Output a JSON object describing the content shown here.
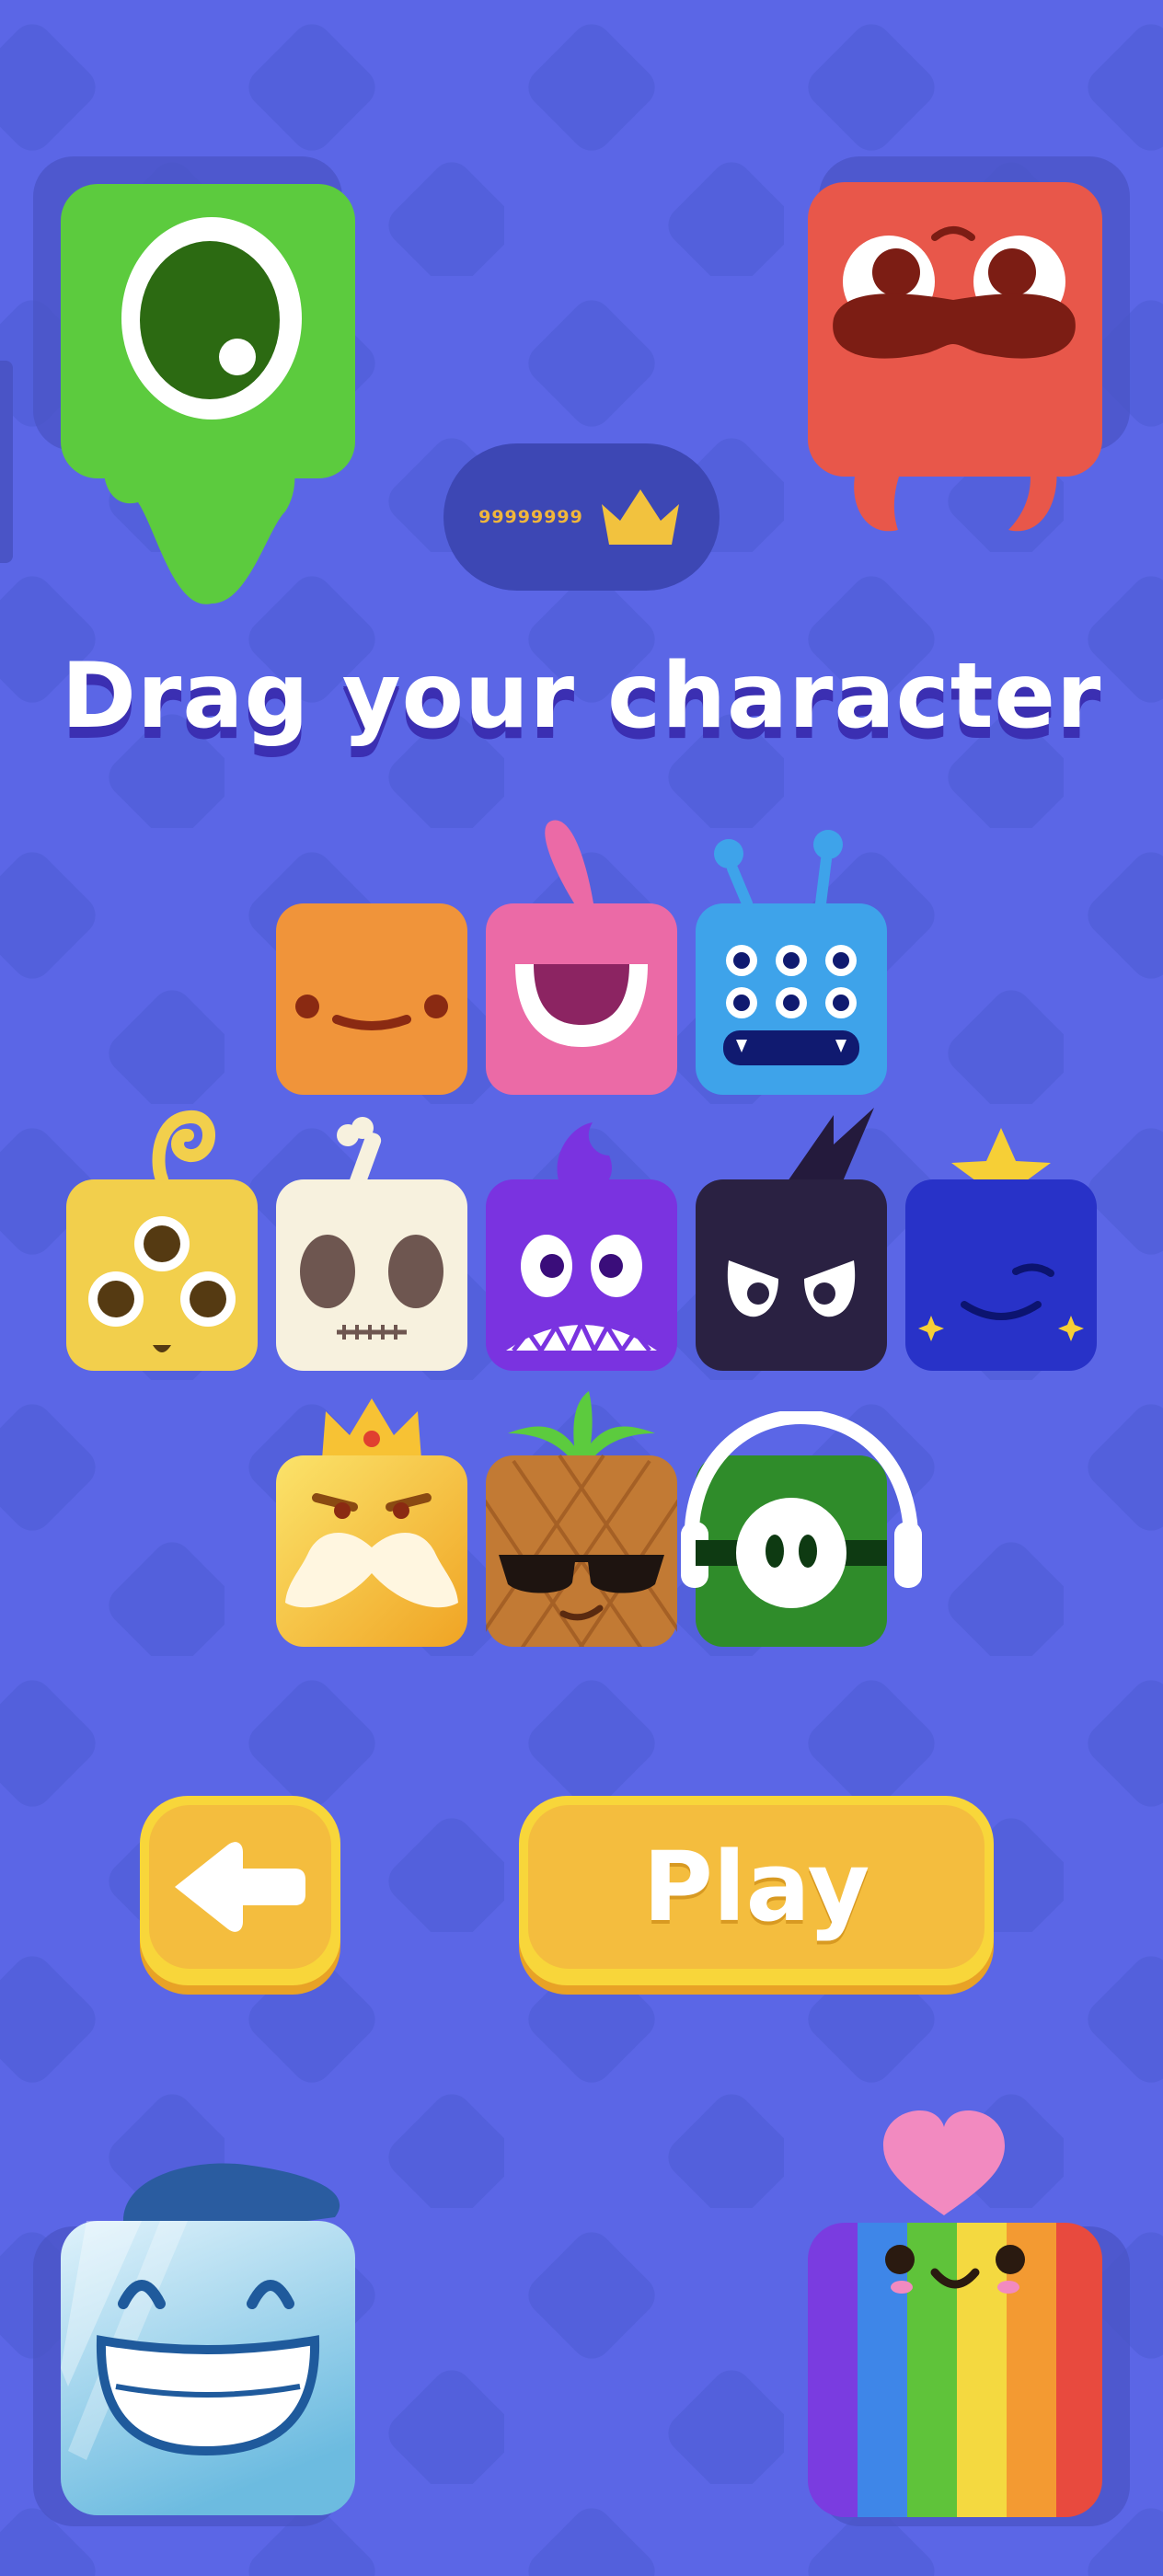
{
  "colors": {
    "background": "#5b66e6",
    "background_pattern": "#5360dc",
    "button_face": "#f4bd3e",
    "button_rim": "#f8d63a",
    "score_color": "#f0b63c"
  },
  "score": {
    "value": "99999999",
    "icon": "crown-icon"
  },
  "title": "Drag your character",
  "buttons": {
    "back_icon": "arrow-left-icon",
    "play_label": "Play"
  },
  "corner_characters": [
    {
      "id": "green-cyclops",
      "color": "#5ccb3e"
    },
    {
      "id": "red-mustache",
      "color": "#e8574a"
    },
    {
      "id": "ice-grin",
      "color": "#b6def2"
    },
    {
      "id": "rainbow-heart",
      "color": "#f28ac0"
    }
  ],
  "character_grid": [
    [
      "orange-smile",
      "pink-cyclops",
      "blue-six-eyes"
    ],
    [
      "yellow-three-eyes",
      "skull-bone",
      "purple-fangs",
      "dark-ninja",
      "navy-star"
    ],
    [
      "king-mustache",
      "pineapple-shades",
      "green-headphones"
    ]
  ]
}
